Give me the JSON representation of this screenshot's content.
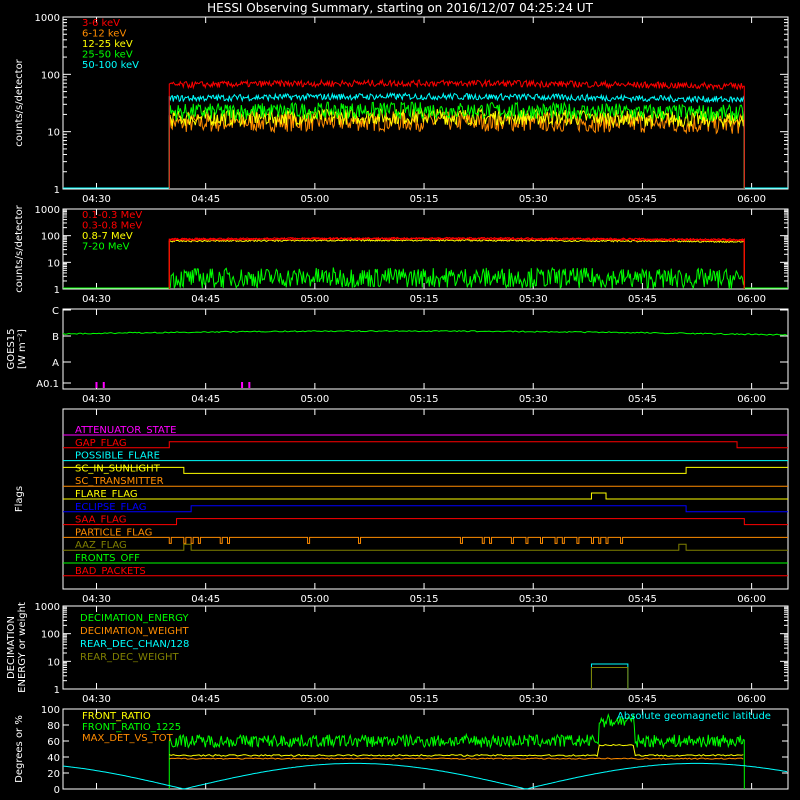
{
  "title": "HESSI Observing Summary, starting on 2016/12/07 04:25:24 UT",
  "colors": {
    "red": "#ff0000",
    "orange": "#ff8c00",
    "yellow": "#ffff00",
    "green": "#00ff00",
    "cyan": "#00ffff",
    "magenta": "#ff00ff",
    "blue": "#0000ff",
    "olive": "#808000",
    "white": "#ffffff"
  },
  "time_ticks": [
    "04:30",
    "04:45",
    "05:00",
    "05:15",
    "05:30",
    "05:45",
    "06:00"
  ],
  "chart_data": [
    {
      "id": "panel1",
      "type": "line",
      "ylabel": "counts/s/detector",
      "ytick_labels": [
        "1",
        "10",
        "100",
        "1000"
      ],
      "yscale": "log",
      "ylim": [
        1,
        1000
      ],
      "xlim": [
        "04:25:24",
        "06:05:00"
      ],
      "data_start": "04:40",
      "data_end": "05:59",
      "series": [
        {
          "name": "3-6 keV",
          "color": "#ff0000",
          "level": 65,
          "jitter": 0.06,
          "step_time": null
        },
        {
          "name": "6-12 keV",
          "color": "#ff8c00",
          "level": 14,
          "jitter": 0.18,
          "step_time": null
        },
        {
          "name": "12-25 keV",
          "color": "#ffff00",
          "level": 17,
          "jitter": 0.15,
          "step_time": null
        },
        {
          "name": "25-50 keV",
          "color": "#00ff00",
          "level": 22,
          "jitter": 0.15,
          "step_time": null
        },
        {
          "name": "50-100 keV",
          "color": "#00ffff",
          "level": 38,
          "jitter": 0.06,
          "step_time": null
        }
      ]
    },
    {
      "id": "panel2",
      "type": "line",
      "ylabel": "counts/s/detector",
      "ytick_labels": [
        "1",
        "10",
        "100",
        "1000"
      ],
      "yscale": "log",
      "ylim": [
        1,
        1000
      ],
      "xlim": [
        "04:25:24",
        "06:05:00"
      ],
      "data_start": "04:40",
      "data_end": "05:59",
      "series": [
        {
          "name": "0.1-0.3 MeV",
          "color": "#ff0000",
          "level": 75,
          "jitter": 0.03,
          "step_time": null
        },
        {
          "name": "0.3-0.8 MeV",
          "color": "#ff0000",
          "level": 70,
          "jitter": 0.03,
          "step_time": null
        },
        {
          "name": "0.8-7 MeV",
          "color": "#ffff00",
          "level": 62,
          "jitter": 0.03,
          "step_time": null
        },
        {
          "name": "7-20 MeV",
          "color": "#00ff00",
          "level": 2.5,
          "jitter": 0.4,
          "step_time": null
        }
      ]
    },
    {
      "id": "panel3",
      "type": "line",
      "ylabel": "GOES15 [W m⁻²]",
      "ylabel_line1": "GOES15",
      "ylabel_line2": "[W m⁻²]",
      "ytick_labels": [
        "A0.1",
        "A",
        "B",
        "C"
      ],
      "series": [
        {
          "name": "GOES15",
          "color": "#00ff00",
          "level": 1.5
        }
      ],
      "markers_color": "#ff00ff",
      "marker_times": [
        "04:30",
        "04:31",
        "04:50",
        "04:51"
      ]
    },
    {
      "id": "panel4",
      "type": "line",
      "ylabel": "Flags",
      "flags": [
        {
          "name": "ATTENUATOR_STATE",
          "color": "#ff00ff"
        },
        {
          "name": "GAP_FLAG",
          "color": "#ff0000"
        },
        {
          "name": "POSSIBLE_FLARE",
          "color": "#00ffff"
        },
        {
          "name": "SC_IN_SUNLIGHT",
          "color": "#ffff00"
        },
        {
          "name": "SC_TRANSMITTER",
          "color": "#ff8c00"
        },
        {
          "name": "FLARE_FLAG",
          "color": "#ffff00"
        },
        {
          "name": "ECLIPSE_FLAG",
          "color": "#0000ff"
        },
        {
          "name": "SAA_FLAG",
          "color": "#ff0000"
        },
        {
          "name": "PARTICLE_FLAG",
          "color": "#ff8c00"
        },
        {
          "name": "AAZ_FLAG",
          "color": "#808000"
        },
        {
          "name": "FRONTS_OFF",
          "color": "#00ff00"
        },
        {
          "name": "BAD_PACKETS",
          "color": "#ff0000"
        }
      ]
    },
    {
      "id": "panel5",
      "type": "line",
      "ylabel": "DECIMATION ENERGY or weight",
      "ylabel_line1": "DECIMATION",
      "ylabel_line2": "ENERGY or weight",
      "ytick_labels": [
        "1",
        "10",
        "100",
        "1000"
      ],
      "series": [
        {
          "name": "DECIMATION_ENERGY",
          "color": "#00ff00"
        },
        {
          "name": "DECIMATION_WEIGHT",
          "color": "#ff8c00"
        },
        {
          "name": "REAR_DEC_CHAN/128",
          "color": "#00ffff"
        },
        {
          "name": "REAR_DEC_WEIGHT",
          "color": "#808000"
        }
      ]
    },
    {
      "id": "panel6",
      "type": "line",
      "ylabel": "Degrees or %",
      "ytick_labels": [
        "0",
        "20",
        "40",
        "60",
        "80",
        "100"
      ],
      "ylim": [
        0,
        100
      ],
      "series": [
        {
          "name": "FRONT_RATIO",
          "color": "#ffff00"
        },
        {
          "name": "FRONT_RATIO_1225",
          "color": "#00ff00"
        },
        {
          "name": "MAX_DET_VS_TOT",
          "color": "#ff8c00"
        },
        {
          "name": "Absolute geomagnetic latitude",
          "color": "#00ffff"
        }
      ]
    }
  ]
}
